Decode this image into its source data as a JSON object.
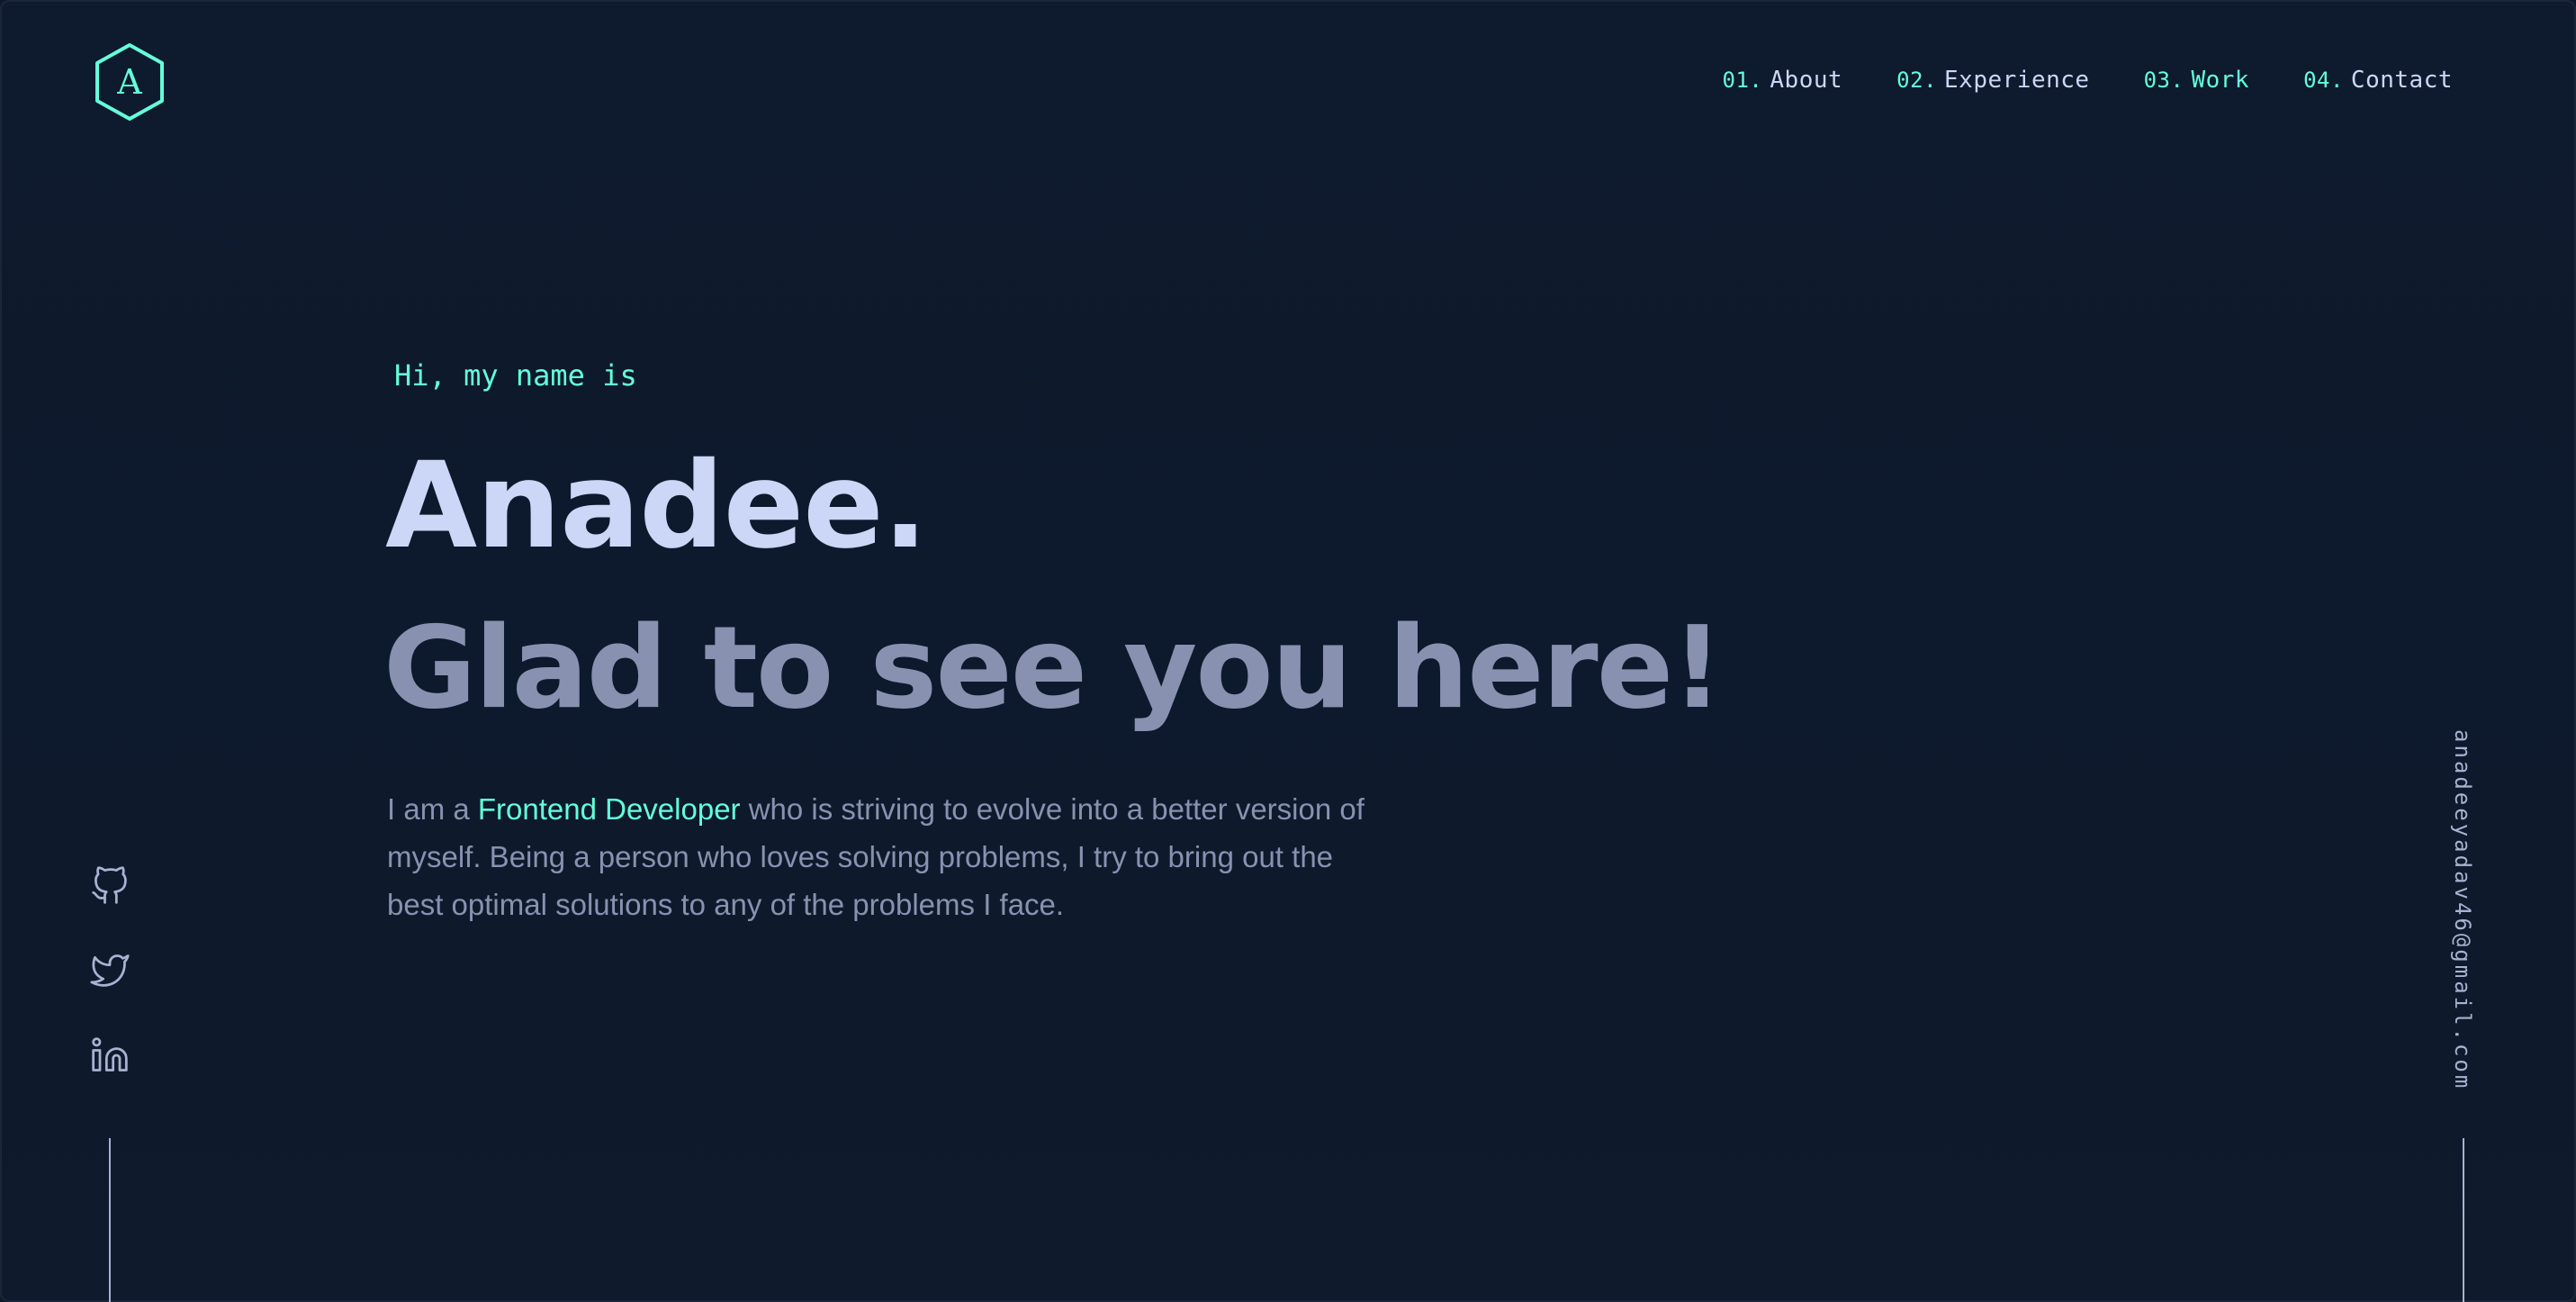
{
  "logo": {
    "letter": "A"
  },
  "nav": {
    "items": [
      {
        "num": "01.",
        "label": "About"
      },
      {
        "num": "02.",
        "label": "Experience"
      },
      {
        "num": "03.",
        "label": "Work"
      },
      {
        "num": "04.",
        "label": "Contact"
      }
    ],
    "active_item": "Work"
  },
  "hero": {
    "greeting": "Hi, my name is",
    "name": "Anadee.",
    "tagline": "Glad to see you here!",
    "intro_before": "I am a ",
    "intro_highlight": "Frontend Developer",
    "intro_after": " who is striving to evolve into a better version of myself. Being a person who loves solving problems, I try to bring out the best optimal solutions to any of the problems I face."
  },
  "social": {
    "icons": [
      "github-icon",
      "twitter-icon",
      "linkedin-icon"
    ]
  },
  "email": "anadeeyadav46@gmail.com",
  "colors": {
    "background": "#0e1829",
    "accent": "#64ffda",
    "heading": "#ccd6f6",
    "text": "#8892b0"
  }
}
